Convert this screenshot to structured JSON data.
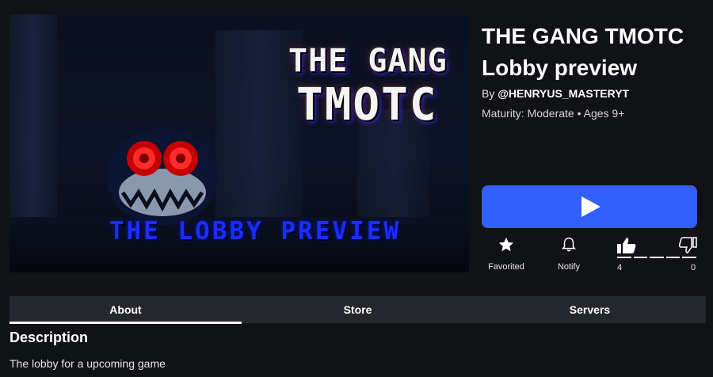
{
  "thumbnail": {
    "title_line1": "THE GANG",
    "title_line2": "TMOTC",
    "subtitle": "THE LOBBY PREVIEW"
  },
  "game": {
    "title": "THE GANG TMOTC Lobby preview",
    "creator_prefix": "By",
    "creator_name": "@HENRYUS_MASTERYT",
    "maturity": "Maturity: Moderate • Ages 9+"
  },
  "actions": {
    "favorite_label": "Favorited",
    "notify_label": "Notify",
    "upvotes": "4",
    "downvotes": "0"
  },
  "tabs": [
    {
      "label": "About",
      "active": true
    },
    {
      "label": "Store",
      "active": false
    },
    {
      "label": "Servers",
      "active": false
    }
  ],
  "description": {
    "heading": "Description",
    "text": "The lobby for a upcoming game"
  },
  "colors": {
    "background": "#111216",
    "play_button": "#335fff",
    "tab_bar": "#25272c"
  },
  "icons": {
    "play": "play-icon",
    "favorite": "star-icon",
    "notify": "bell-icon",
    "upvote": "thumbs-up-icon",
    "downvote": "thumbs-down-icon"
  }
}
